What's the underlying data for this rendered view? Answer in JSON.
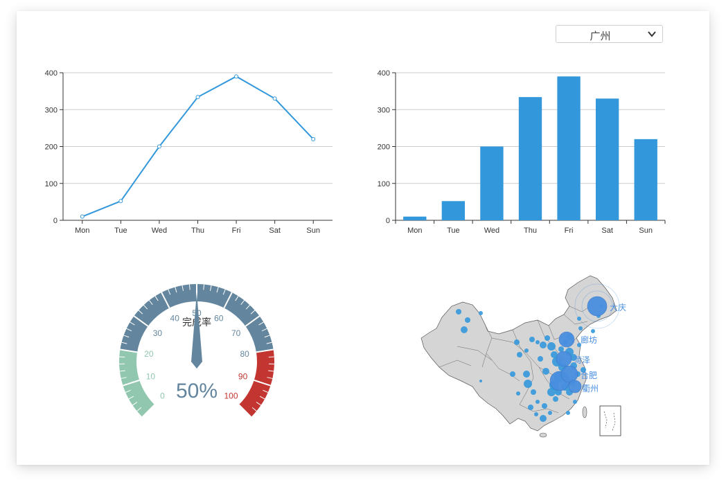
{
  "city_select": {
    "selected": "广州"
  },
  "chart_data": [
    {
      "type": "line",
      "categories": [
        "Mon",
        "Tue",
        "Wed",
        "Thu",
        "Fri",
        "Sat",
        "Sun"
      ],
      "values": [
        10,
        52,
        200,
        334,
        390,
        330,
        220
      ],
      "yticks": [
        0,
        100,
        200,
        300,
        400
      ],
      "ylim": [
        0,
        400
      ],
      "grid": true,
      "color": "#3398DB"
    },
    {
      "type": "bar",
      "categories": [
        "Mon",
        "Tue",
        "Wed",
        "Thu",
        "Fri",
        "Sat",
        "Sun"
      ],
      "values": [
        10,
        52,
        200,
        334,
        390,
        330,
        220
      ],
      "yticks": [
        0,
        100,
        200,
        300,
        400
      ],
      "ylim": [
        0,
        400
      ],
      "grid": true,
      "color": "#3398DB"
    },
    {
      "type": "gauge",
      "title": "完成率",
      "value": 50,
      "value_label": "50%",
      "min": 0,
      "max": 100,
      "tick_labels": [
        "0",
        "10",
        "20",
        "30",
        "40",
        "50",
        "60",
        "70",
        "80",
        "90",
        "100"
      ],
      "bands": [
        {
          "to": 0.2,
          "color": "#91c7ae"
        },
        {
          "to": 0.8,
          "color": "#63869e"
        },
        {
          "to": 1.0,
          "color": "#c23531"
        }
      ]
    },
    {
      "type": "map",
      "region": "China",
      "labels": [
        "大庆",
        "廊坊",
        "菏泽",
        "合肥",
        "衢州"
      ],
      "point_color": "#3398DB",
      "highlight_color": "#4a8fe0"
    }
  ]
}
